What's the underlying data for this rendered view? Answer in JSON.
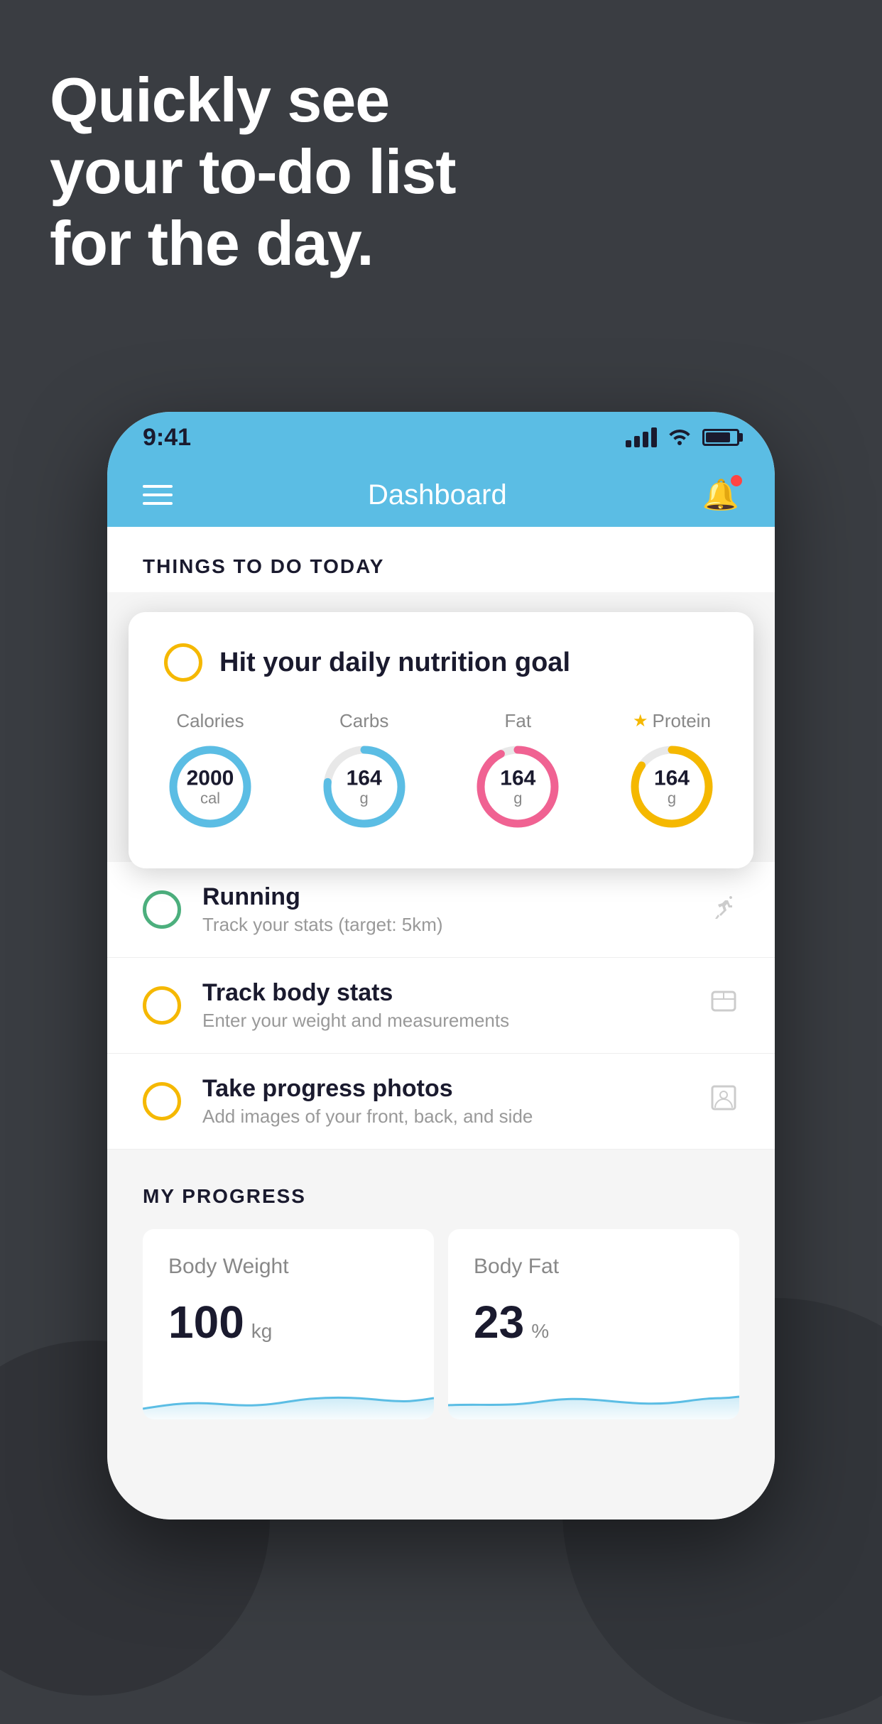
{
  "hero": {
    "line1": "Quickly see",
    "line2": "your to-do list",
    "line3": "for the day."
  },
  "status_bar": {
    "time": "9:41"
  },
  "nav": {
    "title": "Dashboard"
  },
  "section1": {
    "header": "THINGS TO DO TODAY"
  },
  "floating_card": {
    "title": "Hit your daily nutrition goal",
    "nutrition": [
      {
        "label": "Calories",
        "value": "2000",
        "unit": "cal",
        "color": "#5bbde4",
        "track_pct": 65,
        "starred": false
      },
      {
        "label": "Carbs",
        "value": "164",
        "unit": "g",
        "color": "#5bbde4",
        "track_pct": 50,
        "starred": false
      },
      {
        "label": "Fat",
        "value": "164",
        "unit": "g",
        "color": "#f06292",
        "track_pct": 60,
        "starred": false
      },
      {
        "label": "Protein",
        "value": "164",
        "unit": "g",
        "color": "#f5b800",
        "track_pct": 55,
        "starred": true
      }
    ]
  },
  "todo_items": [
    {
      "title": "Running",
      "subtitle": "Track your stats (target: 5km)",
      "checkbox_color": "#4caf7d",
      "icon": "🏃"
    },
    {
      "title": "Track body stats",
      "subtitle": "Enter your weight and measurements",
      "checkbox_color": "#f5b800",
      "icon": "⚖️"
    },
    {
      "title": "Take progress photos",
      "subtitle": "Add images of your front, back, and side",
      "checkbox_color": "#f5b800",
      "icon": "🖼"
    }
  ],
  "progress": {
    "header": "MY PROGRESS",
    "cards": [
      {
        "title": "Body Weight",
        "value": "100",
        "unit": "kg"
      },
      {
        "title": "Body Fat",
        "value": "23",
        "unit": "%"
      }
    ]
  }
}
